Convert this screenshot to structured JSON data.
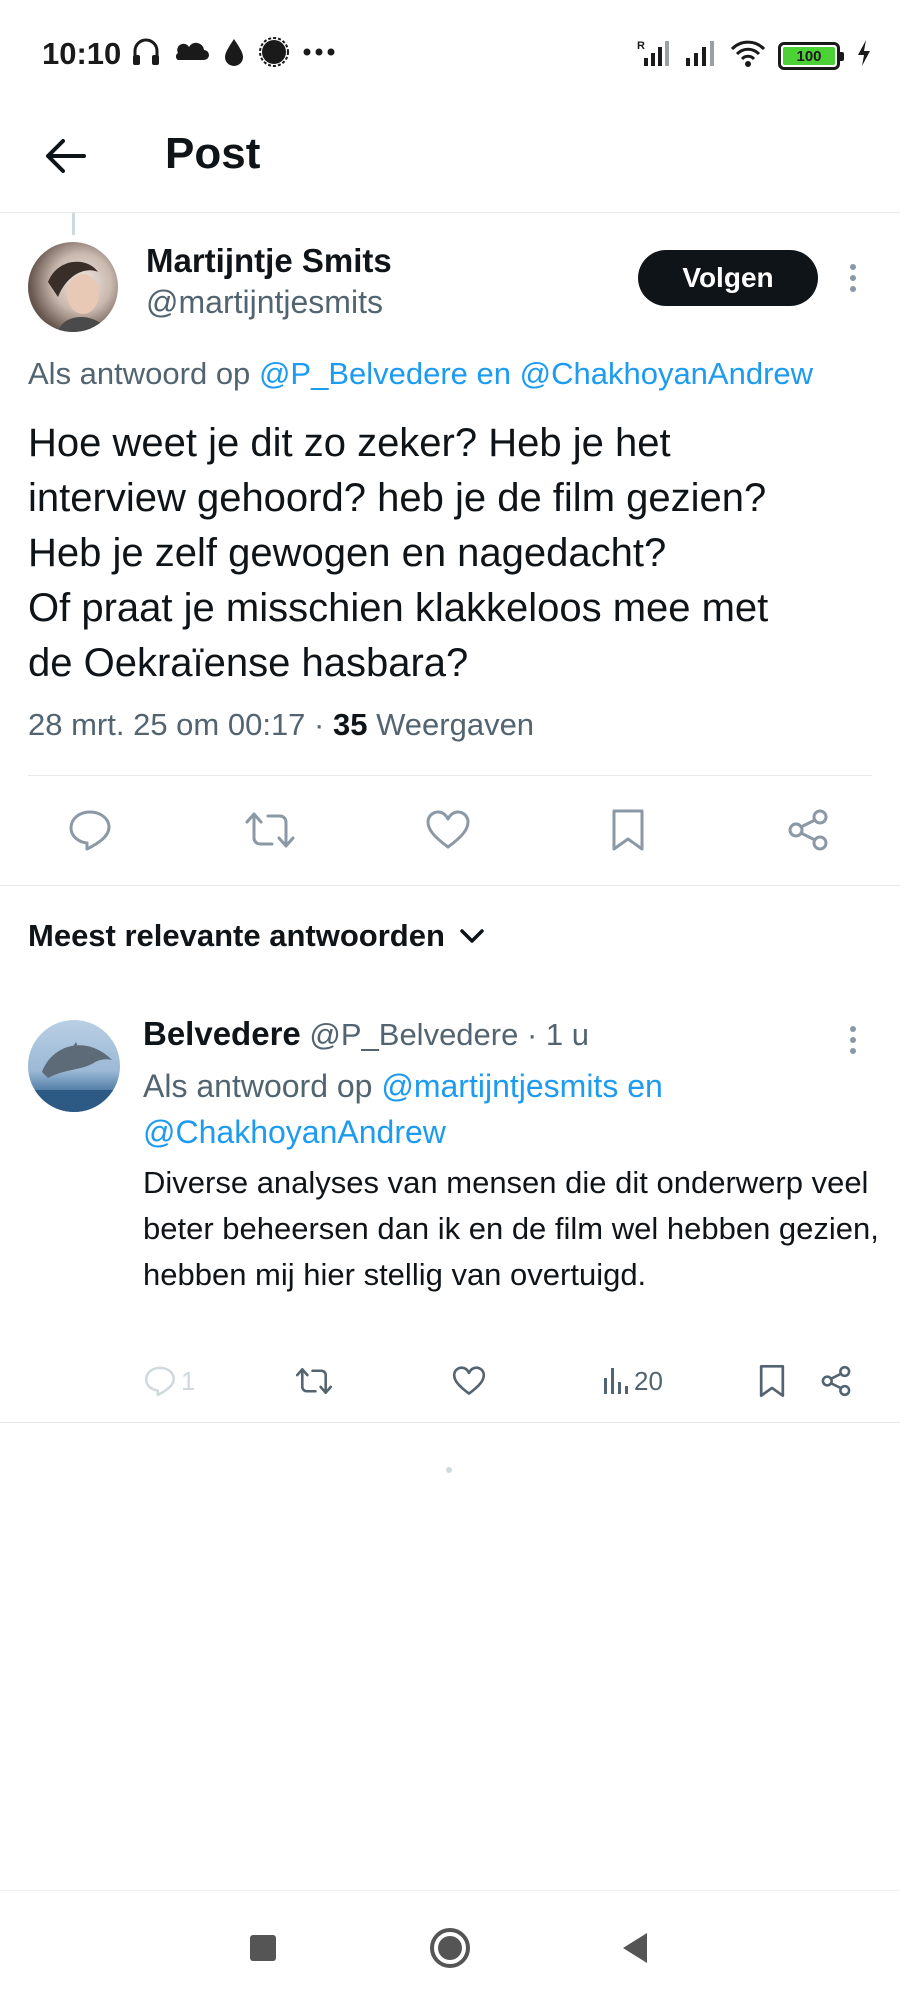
{
  "status_bar": {
    "time": "10:10",
    "battery": "100",
    "icons_left": [
      "headphones-icon",
      "cloud-icon",
      "drop-icon",
      "signal-app-icon",
      "more-dots-icon"
    ],
    "icons_right": [
      "signal-r-icon",
      "signal-icon",
      "wifi-icon",
      "battery-icon",
      "charging-icon"
    ]
  },
  "header": {
    "title": "Post",
    "back_icon": "arrow-left-icon"
  },
  "main_tweet": {
    "author_name": "Martijntje Smits",
    "author_handle": "@martijntjesmits",
    "follow_label": "Volgen",
    "reply_to_prefix": "Als antwoord op",
    "reply_to_targets": "@P_Belvedere en @ChakhoyanAndrew",
    "text": "Hoe weet je dit zo zeker? Heb je het\ninterview gehoord? heb je de film gezien?\nHeb je zelf gewogen en nagedacht?\nOf praat je misschien klakkeloos mee met\nde Oekraïense hasbara?",
    "timestamp": "28 mrt. 25 om 00:17 · ",
    "views_count": "35",
    "views_label": " Weergaven",
    "actions": [
      "reply-icon",
      "repost-icon",
      "like-icon",
      "bookmark-icon",
      "share-icon"
    ]
  },
  "replies_section": {
    "sort_label": "Meest relevante antwoorden"
  },
  "reply": {
    "author_name": "Belvedere",
    "author_handle": " @P_Belvedere · 1 u",
    "reply_to_prefix": "Als antwoord op ",
    "reply_to_targets": "@martijntjesmits en @ChakhoyanAndrew",
    "text": "Diverse analyses van mensen die dit onderwerp veel beter beheersen dan ik en de film wel hebben gezien, hebben mij hier stellig van overtuigd.",
    "reply_count": "1",
    "views_count": "20"
  },
  "colors": {
    "link": "#1d9bf0",
    "secondary_text": "#536471",
    "primary_text": "#0f1419",
    "follow_button_bg": "#0f1419",
    "battery_fill": "#4cd137"
  }
}
